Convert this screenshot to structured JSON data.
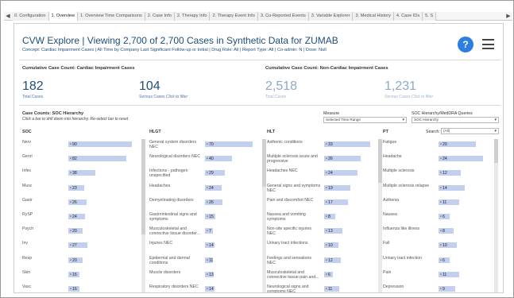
{
  "tabs": {
    "prev": "◀",
    "next": "▶",
    "items": [
      {
        "label": "0. Configuration",
        "active": false
      },
      {
        "label": "1. Overview",
        "active": true
      },
      {
        "label": "1. Overview Time Comparisons",
        "active": false
      },
      {
        "label": "2. Case Info",
        "active": false
      },
      {
        "label": "2. Therapy Info",
        "active": false
      },
      {
        "label": "2. Therapy Event Info",
        "active": false
      },
      {
        "label": "3. Co-Reported Events",
        "active": false
      },
      {
        "label": "3. Variable Explorer",
        "active": false
      },
      {
        "label": "3. Medical History",
        "active": false
      },
      {
        "label": "4. Case IDs",
        "active": false
      },
      {
        "label": "5. S",
        "active": false
      }
    ]
  },
  "header": {
    "title": "CVW Explore | Viewing 2,700 of 2,700 Cases in Synthetic Data for ZUMAB",
    "subtitle": "Concept: Cardiac Impairment Cases  |  All Time by Company Last Significant Follow-up or Initial  |  Drug Role: All  |  Report Type: All  |  Co-admin: N  |  Dose: Null",
    "help_label": "?"
  },
  "kpis": {
    "cardiac": {
      "heading": "Cumulative Case Count: Cardiac Impairment Cases",
      "total_value": "182",
      "total_label": "Total Cases",
      "serious_value": "104",
      "serious_label": "Serious Cases",
      "serious_hint": "Click to filter"
    },
    "noncardiac": {
      "heading": "Cumulative Case Count: Non-Cardiac Impairment Cases",
      "total_value": "2,518",
      "total_label": "Total Cases",
      "serious_value": "1,231",
      "serious_label": "Serious Cases",
      "serious_hint": "Click to filter"
    }
  },
  "section": {
    "title": "Case Counts: SOC Hierarchy",
    "subtitle": "Click a bar to drill down into hierarchy. Re-select bar to reset"
  },
  "filters": {
    "measure_label": "Measure",
    "measure_value": "Selected Time Range",
    "hierarchy_label": "SOC Hierarchy/MedDRA Queries",
    "hierarchy_value": "SOC Hierarchy",
    "caret": "▾"
  },
  "columns": {
    "soc": {
      "header": "SOC",
      "rows": [
        {
          "label": "Nerv",
          "value": 90
        },
        {
          "label": "Genrl",
          "value": 82
        },
        {
          "label": "Infec",
          "value": 38
        },
        {
          "label": "Musc",
          "value": 23
        },
        {
          "label": "Gastr",
          "value": 26
        },
        {
          "label": "RySP",
          "value": 24
        },
        {
          "label": "Psych",
          "value": 20
        },
        {
          "label": "Inv",
          "value": 27
        },
        {
          "label": "Resp",
          "value": 20
        },
        {
          "label": "Skin",
          "value": 16
        },
        {
          "label": "Vasc",
          "value": 16
        }
      ]
    },
    "hlgt": {
      "header": "HLGT",
      "rows": [
        {
          "label": "General system disorders NEC",
          "value": 70
        },
        {
          "label": "Neurological disorders NEC",
          "value": 40
        },
        {
          "label": "Infections - pathogen unspecified",
          "value": 29
        },
        {
          "label": "Headaches",
          "value": 24
        },
        {
          "label": "Demyelinating disorders",
          "value": 26
        },
        {
          "label": "Gastrointestinal signs and symptoms",
          "value": 15
        },
        {
          "label": "Musculoskeletal and connective tissue disorder...",
          "value": 7
        },
        {
          "label": "Injuries NEC",
          "value": 14
        },
        {
          "label": "Epidermal and dermal conditions",
          "value": 11
        },
        {
          "label": "Muscle disorders",
          "value": 13
        },
        {
          "label": "Respiratory disorders NEC",
          "value": 14
        }
      ]
    },
    "hlt": {
      "header": "HLT",
      "rows": [
        {
          "label": "Asthenic conditions",
          "value": 33
        },
        {
          "label": "Multiple sclerosis acute and progressive",
          "value": 26
        },
        {
          "label": "Headaches NEC",
          "value": 24
        },
        {
          "label": "General signs and symptoms NEC",
          "value": 19
        },
        {
          "label": "Pain and discomfort NEC",
          "value": 17
        },
        {
          "label": "Nausea and vomiting symptoms",
          "value": 8
        },
        {
          "label": "Non-site specific injuries NEC",
          "value": 13
        },
        {
          "label": "Urinary tract infections",
          "value": 10
        },
        {
          "label": "Feelings and sensations NEC",
          "value": 12
        },
        {
          "label": "Musculoskeletal and connective tissue pain and...",
          "value": 6
        },
        {
          "label": "Neurological signs and symptoms NEC",
          "value": 11
        }
      ]
    },
    "pt": {
      "header": "PT",
      "search_label": "Search:",
      "search_value": "(All)",
      "rows": [
        {
          "label": "Fatigue",
          "value": 20
        },
        {
          "label": "Headache",
          "value": 24
        },
        {
          "label": "Multiple sclerosis",
          "value": 12
        },
        {
          "label": "Multiple sclerosis relapse",
          "value": 14
        },
        {
          "label": "Asthenia",
          "value": 11
        },
        {
          "label": "Nausea",
          "value": 6
        },
        {
          "label": "Influenza like illness",
          "value": 8
        },
        {
          "label": "Fall",
          "value": 10
        },
        {
          "label": "Urinary tract infection",
          "value": 6
        },
        {
          "label": "Pain",
          "value": 11
        },
        {
          "label": "Depression",
          "value": 9
        }
      ]
    }
  },
  "colors": {
    "title": "#1f4e79",
    "bar": "#c3cfee",
    "accent": "#2e7de0"
  }
}
